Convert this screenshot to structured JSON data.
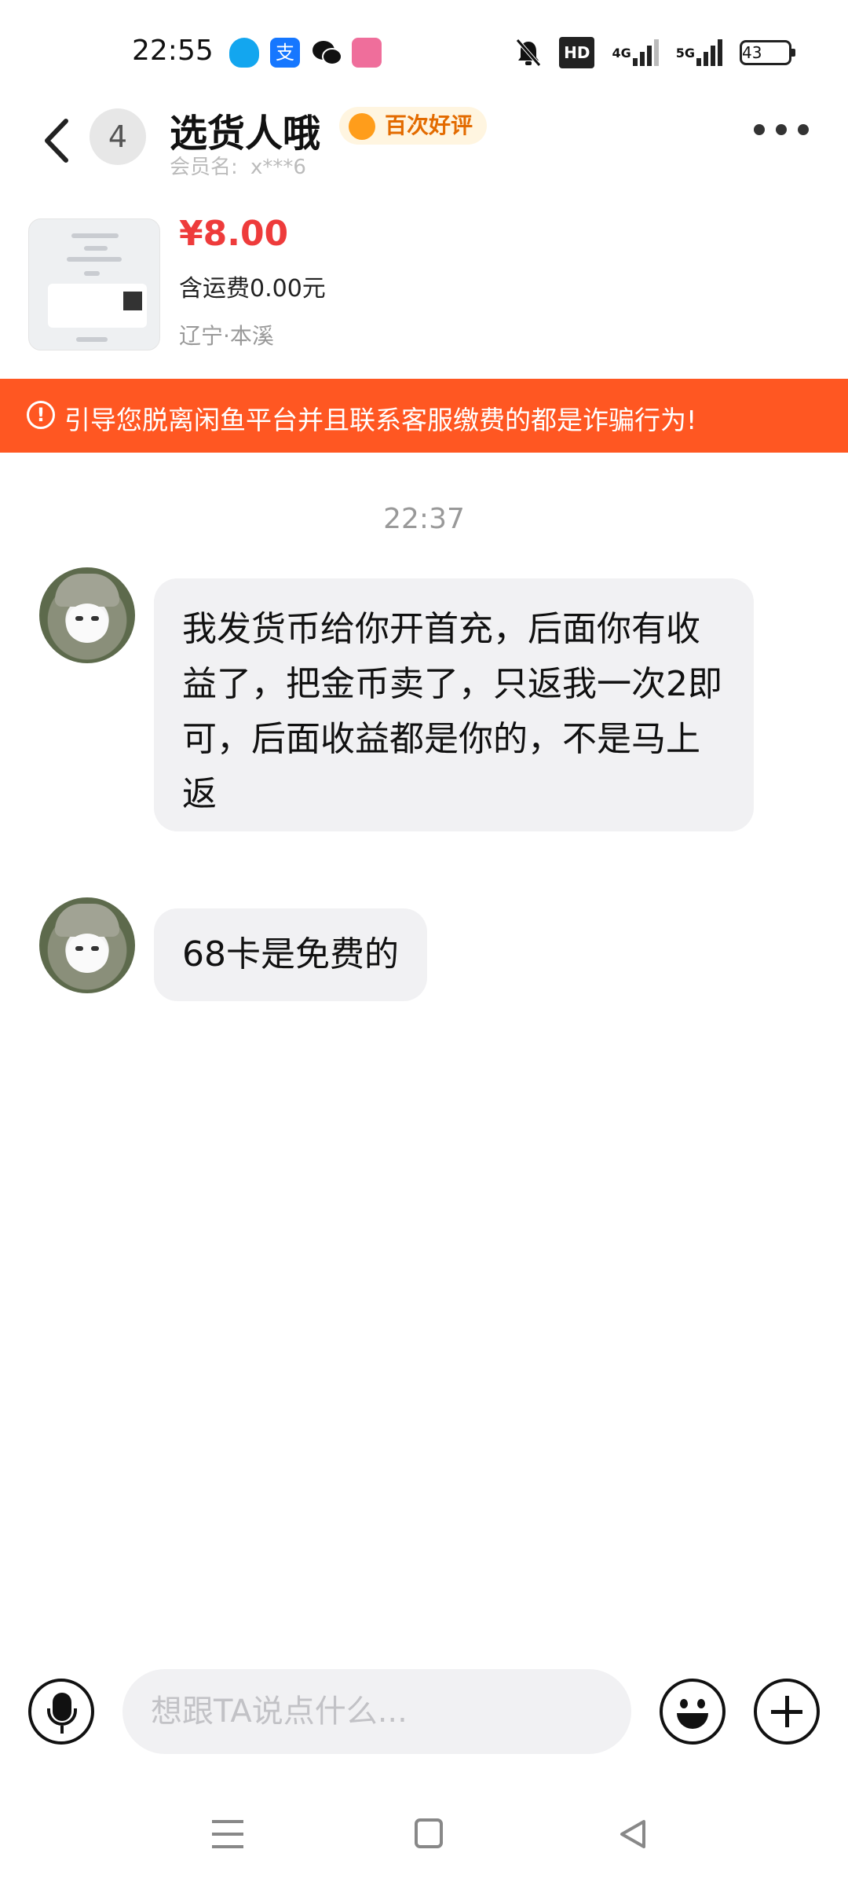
{
  "status_bar": {
    "time": "22:55",
    "app_icons": [
      "qq-icon",
      "alipay-icon",
      "wechat-icon",
      "bilibili-icon"
    ],
    "indicators": [
      "mute-icon",
      "hd-icon",
      "4g-signal-icon",
      "5g-signal-icon"
    ],
    "hd_label": "HD",
    "signal_4g_label": "4G",
    "signal_5g_label": "5G",
    "battery": "43"
  },
  "header": {
    "unread_count": "4",
    "contact_name": "选货人哦",
    "review_badge": "百次好评",
    "member_label": "会员名:",
    "member_value": "x***6"
  },
  "product": {
    "price": "¥8.00",
    "shipping": "含运费0.00元",
    "location": "辽宁·本溪"
  },
  "warning": {
    "text": "引导您脱离闲鱼平台并且联系客服缴费的都是诈骗行为!"
  },
  "chat": {
    "timestamp": "22:37",
    "messages": [
      {
        "sender": "other",
        "text": "我发货币给你开首充，后面你有收益了，把金币卖了，只返我一次2即可，后面收益都是你的，不是马上返"
      },
      {
        "sender": "other",
        "text": "68卡是免费的"
      }
    ]
  },
  "input": {
    "placeholder": "想跟TA说点什么..."
  },
  "colors": {
    "warning_bg": "#ff5722",
    "price": "#ee3b3b",
    "review_badge_text": "#e36b00",
    "bubble_bg": "#f1f1f3"
  }
}
